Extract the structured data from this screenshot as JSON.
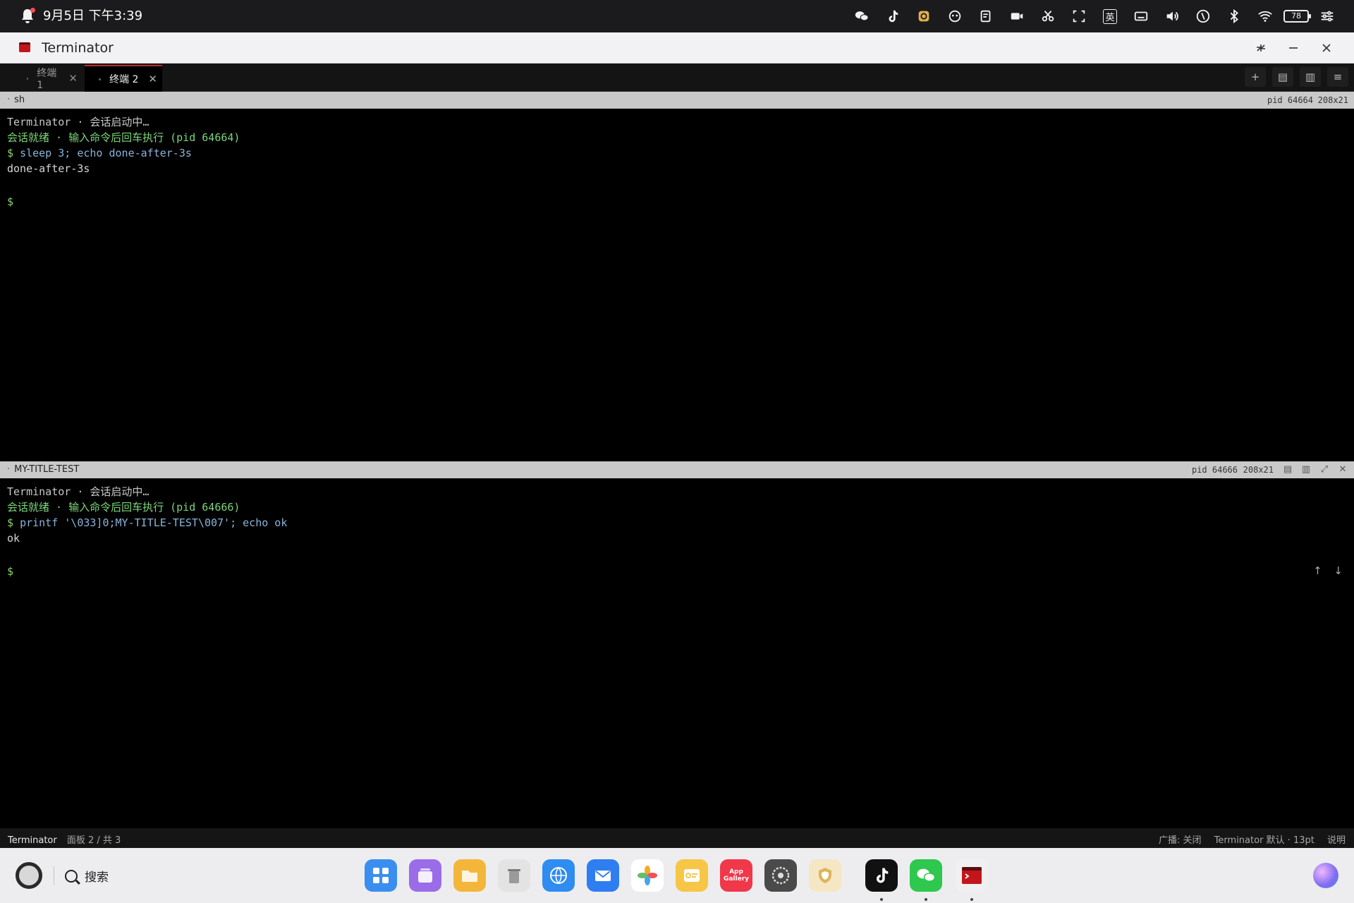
{
  "system_bar": {
    "clock": "9月5日 下午3:39",
    "battery": "78",
    "input_method": "英"
  },
  "window": {
    "title": "Terminator"
  },
  "tabs": [
    {
      "label": "终端 1",
      "active": false
    },
    {
      "label": "终端 2",
      "active": true
    }
  ],
  "tab_tools": {
    "add": "+",
    "split_h": "▤",
    "split_v": "▥",
    "menu": "≡"
  },
  "panes": [
    {
      "title": "sh",
      "pid": "pid 64664",
      "size": "208x21",
      "lines": [
        {
          "text": "Terminator · 会话启动中…",
          "kind": "gray"
        },
        {
          "text": "会话就绪 · 输入命令后回车执行 (pid 64664)",
          "kind": "green"
        },
        {
          "prompt": "$",
          "text": "sleep 3; echo done-after-3s",
          "kind": "cmd"
        },
        {
          "text": "done-after-3s",
          "kind": "out"
        },
        {
          "prompt": "$",
          "text": "",
          "kind": "cmd"
        }
      ]
    },
    {
      "title": "MY-TITLE-TEST",
      "pid": "pid 64666",
      "size": "208x21",
      "lines": [
        {
          "text": "Terminator · 会话启动中…",
          "kind": "gray"
        },
        {
          "text": "会话就绪 · 输入命令后回车执行 (pid 64666)",
          "kind": "green"
        },
        {
          "prompt": "$",
          "text": "printf '\\033]0;MY-TITLE-TEST\\007'; echo ok",
          "kind": "cmd"
        },
        {
          "text": "ok",
          "kind": "out"
        },
        {
          "prompt": "$",
          "text": "",
          "kind": "cmd"
        }
      ],
      "scroll_up": "↑",
      "scroll_down": "↓"
    }
  ],
  "status_bar": {
    "app": "Terminator",
    "pane_info": "面板 2 / 共 3",
    "broadcast": "广播: 关闭",
    "profile": "Terminator 默认 · 13pt",
    "help": "说明"
  },
  "dock": {
    "search_label": "搜索",
    "apps": [
      {
        "name": "launcher",
        "color": "#3a8ef0"
      },
      {
        "name": "multitask",
        "color": "#9b6ce8"
      },
      {
        "name": "files",
        "color": "#f4b63a"
      },
      {
        "name": "trash",
        "color": "#b8b8b8"
      },
      {
        "name": "browser",
        "color": "#2f8cf0"
      },
      {
        "name": "mail",
        "color": "#2e7ef2"
      },
      {
        "name": "photos",
        "color": "#ffffff"
      },
      {
        "name": "notes",
        "color": "#f7c646"
      },
      {
        "name": "app-gallery",
        "color": "#f0384a",
        "label": "App Gallery"
      },
      {
        "name": "settings",
        "color": "#4a4a4a"
      },
      {
        "name": "security",
        "color": "#e0b45a"
      },
      {
        "name": "tiktok",
        "color": "#111111"
      },
      {
        "name": "wechat",
        "color": "#2dc84d"
      },
      {
        "name": "terminator",
        "color": "#c3161c"
      }
    ]
  }
}
